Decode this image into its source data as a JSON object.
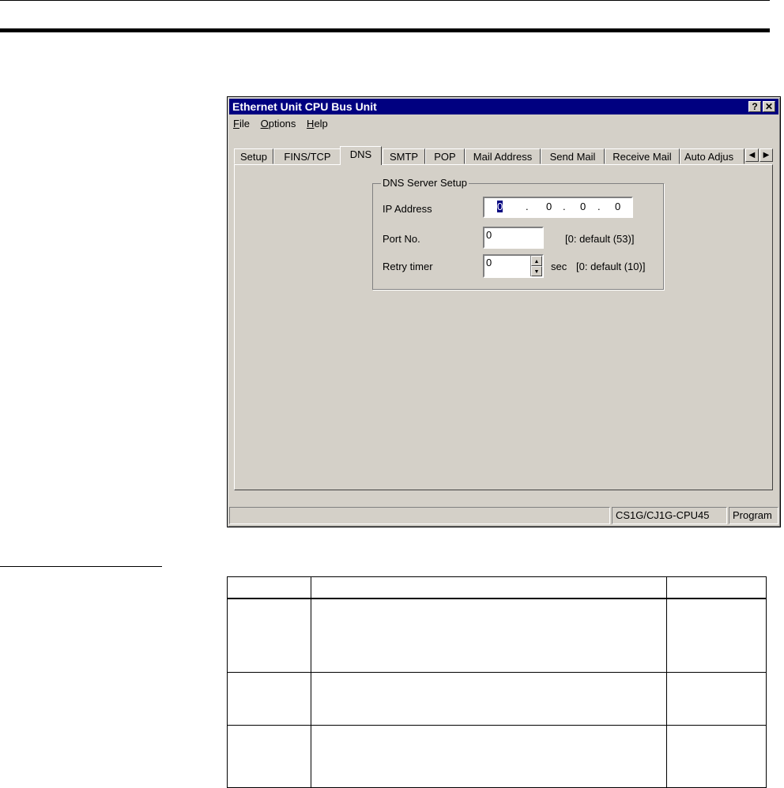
{
  "window": {
    "title": "Ethernet Unit CPU Bus Unit",
    "help_button": "?",
    "close_button": "✕",
    "menu": [
      "File",
      "Options",
      "Help"
    ],
    "tabs": [
      "Setup",
      "FINS/TCP",
      "DNS",
      "SMTP",
      "POP",
      "Mail Address",
      "Send Mail",
      "Receive Mail",
      "Auto Adjus"
    ],
    "active_tab": "DNS",
    "scroll_left": "◀",
    "scroll_right": "▶"
  },
  "dns": {
    "group_title": "DNS Server Setup",
    "ip_label": "IP Address",
    "ip_octets": [
      "0",
      "0",
      "0",
      "0"
    ],
    "ip_dot": ".",
    "port_label": "Port No.",
    "port_value": "0",
    "port_hint": "[0: default (53)]",
    "retry_label": "Retry timer",
    "retry_value": "0",
    "retry_unit": "sec",
    "retry_hint": "[0: default (10)]"
  },
  "status": {
    "model": "CS1G/CJ1G-CPU45",
    "mode": "Program"
  },
  "table": {
    "rows": 4
  }
}
